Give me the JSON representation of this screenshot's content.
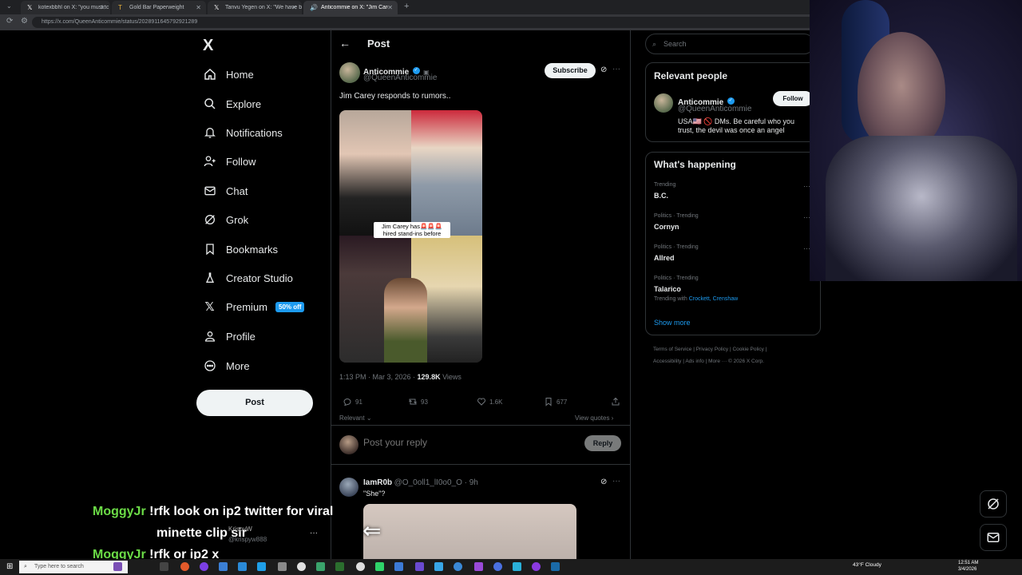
{
  "browser": {
    "tabs": [
      {
        "title": "kotexbbhl on X: \"you must to go li"
      },
      {
        "title": "Gold Bar Paperweight"
      },
      {
        "title": "Tanvu Yegen on X: \"We have been"
      },
      {
        "title": "Anticommie on X: \"Jim Carey"
      }
    ],
    "url": "https://x.com/QueenAnticommie/status/2028911645792921289",
    "new_tab_icon": "plus-icon"
  },
  "sidebar": {
    "logo": "X",
    "items": [
      {
        "label": "Home",
        "icon": "home-icon"
      },
      {
        "label": "Explore",
        "icon": "search-icon"
      },
      {
        "label": "Notifications",
        "icon": "bell-icon"
      },
      {
        "label": "Follow",
        "icon": "person-plus-icon"
      },
      {
        "label": "Chat",
        "icon": "mail-icon"
      },
      {
        "label": "Grok",
        "icon": "grok-icon"
      },
      {
        "label": "Bookmarks",
        "icon": "bookmark-icon"
      },
      {
        "label": "Creator Studio",
        "icon": "flask-icon"
      },
      {
        "label": "Premium",
        "icon": "x-icon",
        "badge": "50% off"
      },
      {
        "label": "Profile",
        "icon": "person-icon"
      },
      {
        "label": "More",
        "icon": "more-circle-icon"
      }
    ],
    "post_button": "Post"
  },
  "main": {
    "header": "Post",
    "tweet": {
      "name": "Anticommie",
      "handle": "@QueenAnticommie",
      "subscribe": "Subscribe",
      "text": "Jim Carey responds to rumors..",
      "media_caption": "Jim Carey has🚨🚨🚨 hired stand-ins before",
      "time": "1:13 PM · Mar 3, 2026 · ",
      "views": "129.8K",
      "views_label": " Views",
      "replies": "91",
      "reposts": "93",
      "likes": "1.6K",
      "bookmarks": "677"
    },
    "sort": "Relevant",
    "view_quotes": "View quotes",
    "reply_placeholder": "Post your reply",
    "reply_button": "Reply",
    "reply2": {
      "name": "IamR0b",
      "handle": "@O_0oll1_lI0o0_O · 9h",
      "text": "\"She\"?"
    }
  },
  "right": {
    "search_placeholder": "Search",
    "relevant_title": "Relevant people",
    "person": {
      "name": "Anticommie",
      "handle": "@QueenAnticommie",
      "bio": "USA🇺🇸 🚫 DMs. Be careful who you trust, the devil was once an angel",
      "follow": "Follow"
    },
    "happening_title": "What's happening",
    "trends": [
      {
        "category": "Trending",
        "name": "B.C."
      },
      {
        "category": "Politics · Trending",
        "name": "Cornyn"
      },
      {
        "category": "Politics · Trending",
        "name": "Allred"
      },
      {
        "category": "Politics · Trending",
        "name": "Talarico",
        "with_label": "Trending with ",
        "with": "Crockett, Crenshaw"
      }
    ],
    "show_more": "Show more",
    "footer_line1": "Terms of Service  |  Privacy Policy  |  Cookie Policy  |",
    "footer_line2": "Accessibility  |  Ads info  |  More ···  © 2026 X Corp."
  },
  "chat_overlay": [
    {
      "user": "MoggyJr",
      "msg": "!rfk look on ip2 twitter for viral"
    },
    {
      "user": "",
      "msg": "minette clip sir"
    },
    {
      "user": "MoggyJr",
      "msg": "!rfk or ip2 x"
    }
  ],
  "overlay_account": {
    "name": "KrispyW",
    "handle": "@krispyw888"
  },
  "taskbar": {
    "search_placeholder": "Type here to search",
    "weather": "43°F  Cloudy",
    "time": "12:51 AM",
    "date": "3/4/2026"
  },
  "colors": {
    "accent": "#1d9bf0",
    "chat_user": "#6cdc47",
    "badge": "#1d9bf0"
  }
}
